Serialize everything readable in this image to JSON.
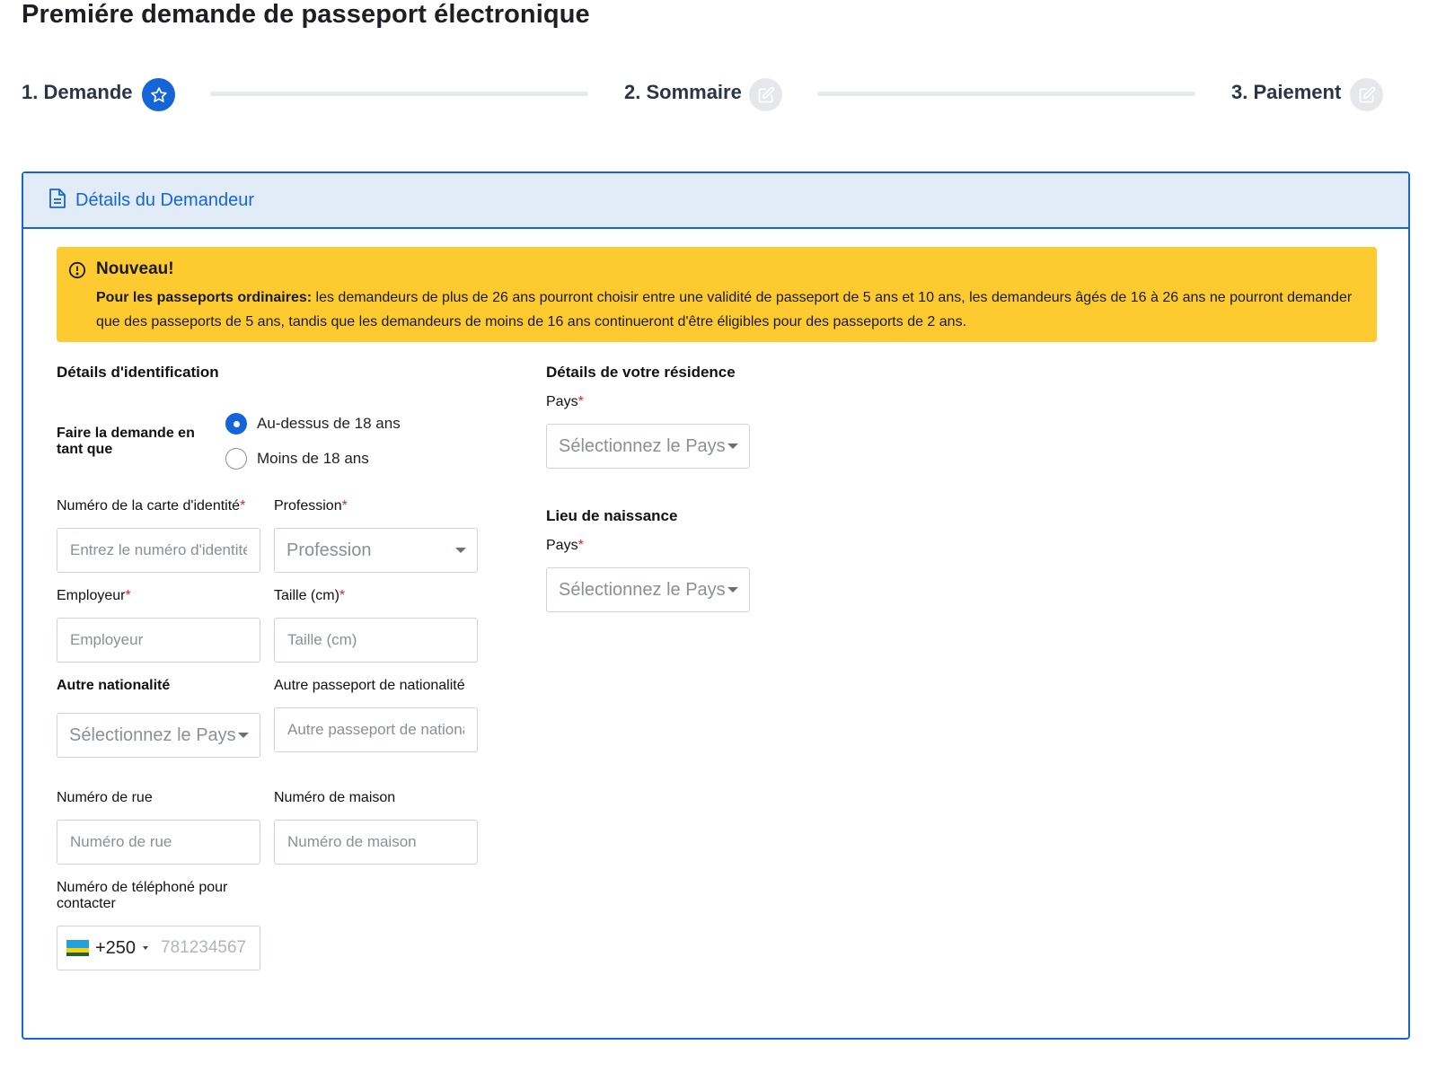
{
  "page": {
    "title": "Premiére demande de passeport électronique"
  },
  "stepper": {
    "steps": [
      {
        "label": "1. Demande",
        "icon": "star-icon",
        "state": "active"
      },
      {
        "label": "2. Sommaire",
        "icon": "edit-icon",
        "state": "inactive"
      },
      {
        "label": "3. Paiement",
        "icon": "edit-icon",
        "state": "inactive"
      }
    ]
  },
  "panel": {
    "title": "Détails du Demandeur",
    "icon": "document-icon"
  },
  "alert": {
    "title": "Nouveau!",
    "bold_lead": "Pour les passeports ordinaires:",
    "body": " les demandeurs de plus de 26 ans pourront choisir entre une validité de passeport de 5 ans et 10 ans, les demandeurs âgés de 16 à 26 ans ne pourront demander que des passeports de 5 ans, tandis que les demandeurs de moins de 16 ans continueront d'être éligibles pour des passeports de 2 ans."
  },
  "identification": {
    "title": "Détails d'identification",
    "apply_as_label": "Faire la demande en tant que",
    "options": [
      "Au-dessus de 18 ans",
      "Moins de 18 ans"
    ],
    "selected_option": "Au-dessus de 18 ans",
    "id_number": {
      "label": "Numéro de la carte d'identité",
      "placeholder": "Entrez le numéro d'identité",
      "value": ""
    },
    "profession": {
      "label": "Profession",
      "placeholder": "Profession"
    },
    "employer": {
      "label": "Employeur",
      "placeholder": "Employeur",
      "value": ""
    },
    "height": {
      "label": "Taille (cm)",
      "placeholder": "Taille (cm)",
      "value": ""
    },
    "other_nationality": {
      "label": "Autre nationalité",
      "placeholder": "Sélectionnez le Pays"
    },
    "other_passport": {
      "label": "Autre passeport de nationalité",
      "placeholder": "Autre passeport de nationalité",
      "value": ""
    },
    "street_number": {
      "label": "Numéro de rue",
      "placeholder": "Numéro de rue",
      "value": ""
    },
    "house_number": {
      "label": "Numéro de maison",
      "placeholder": "Numéro de maison",
      "value": ""
    },
    "phone": {
      "label": "Numéro de téléphoné pour contacter",
      "dial_code": "+250",
      "placeholder": "781234567",
      "flag": "rwanda-flag-icon"
    }
  },
  "residence": {
    "title": "Détails de votre résidence",
    "country": {
      "label": "Pays",
      "placeholder": "Sélectionnez le Pays"
    }
  },
  "birthplace": {
    "title": "Lieu de naissance",
    "country": {
      "label": "Pays",
      "placeholder": "Sélectionnez le Pays"
    }
  },
  "required_marker": "*",
  "colors": {
    "primary": "#1565d8",
    "alert": "#fdca2f",
    "required": "#e02424",
    "header_bg": "#e1ecf8"
  }
}
